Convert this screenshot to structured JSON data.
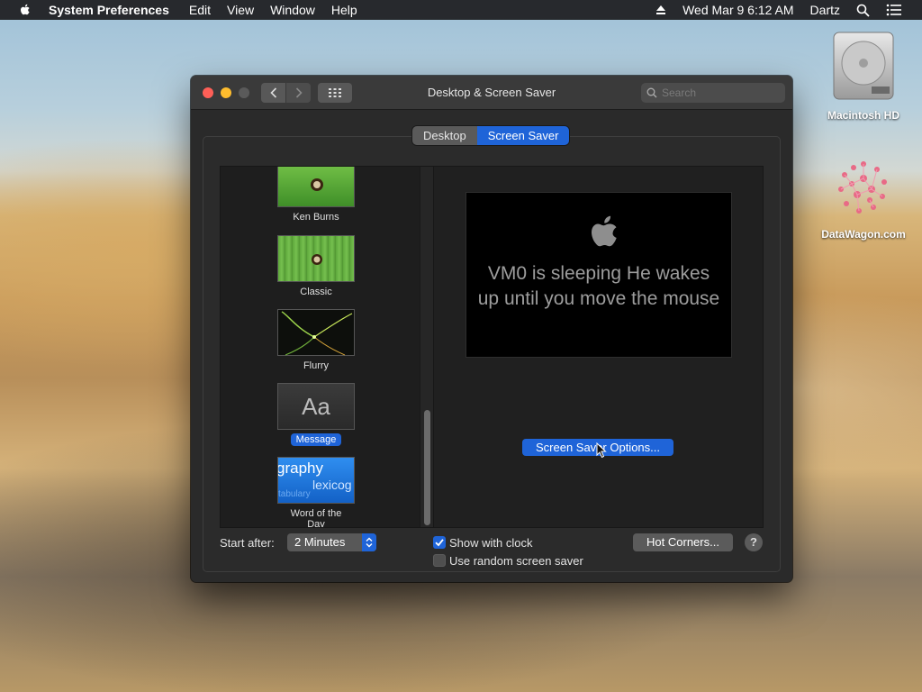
{
  "menubar": {
    "app_name": "System Preferences",
    "menus": [
      "Edit",
      "View",
      "Window",
      "Help"
    ],
    "datetime": "Wed Mar 9  6:12 AM",
    "user": "Dartz"
  },
  "desktop_icons": [
    {
      "label": "Macintosh HD",
      "icon": "hard-drive-icon"
    },
    {
      "label": "DataWagon.com",
      "icon": "datawagon-logo-icon"
    }
  ],
  "window": {
    "title": "Desktop & Screen Saver",
    "search_placeholder": "Search",
    "tabs": [
      {
        "label": "Desktop",
        "active": false
      },
      {
        "label": "Screen Saver",
        "active": true
      }
    ]
  },
  "savers": [
    {
      "label": "Ken Burns",
      "selected": false
    },
    {
      "label": "Classic",
      "selected": false
    },
    {
      "label": "Flurry",
      "selected": false
    },
    {
      "label": "Message",
      "selected": true,
      "thumb_text": "Aa"
    },
    {
      "label": "Word of the Day",
      "selected": false,
      "thumb_words": [
        "graphy",
        "lexicog",
        "tabulary"
      ]
    }
  ],
  "preview": {
    "message": "VM0 is sleeping He wakes up until you move the mouse"
  },
  "options_button": "Screen Saver Options...",
  "bottom": {
    "start_after_label": "Start after:",
    "start_after_value": "2 Minutes",
    "show_clock_label": "Show with clock",
    "show_clock_checked": true,
    "random_label": "Use random screen saver",
    "random_checked": false,
    "hot_corners": "Hot Corners...",
    "help": "?"
  },
  "colors": {
    "accent": "#1f64d8",
    "window_bg": "#2a2a2a",
    "close": "#fe5f57",
    "minimize": "#febc2e"
  }
}
